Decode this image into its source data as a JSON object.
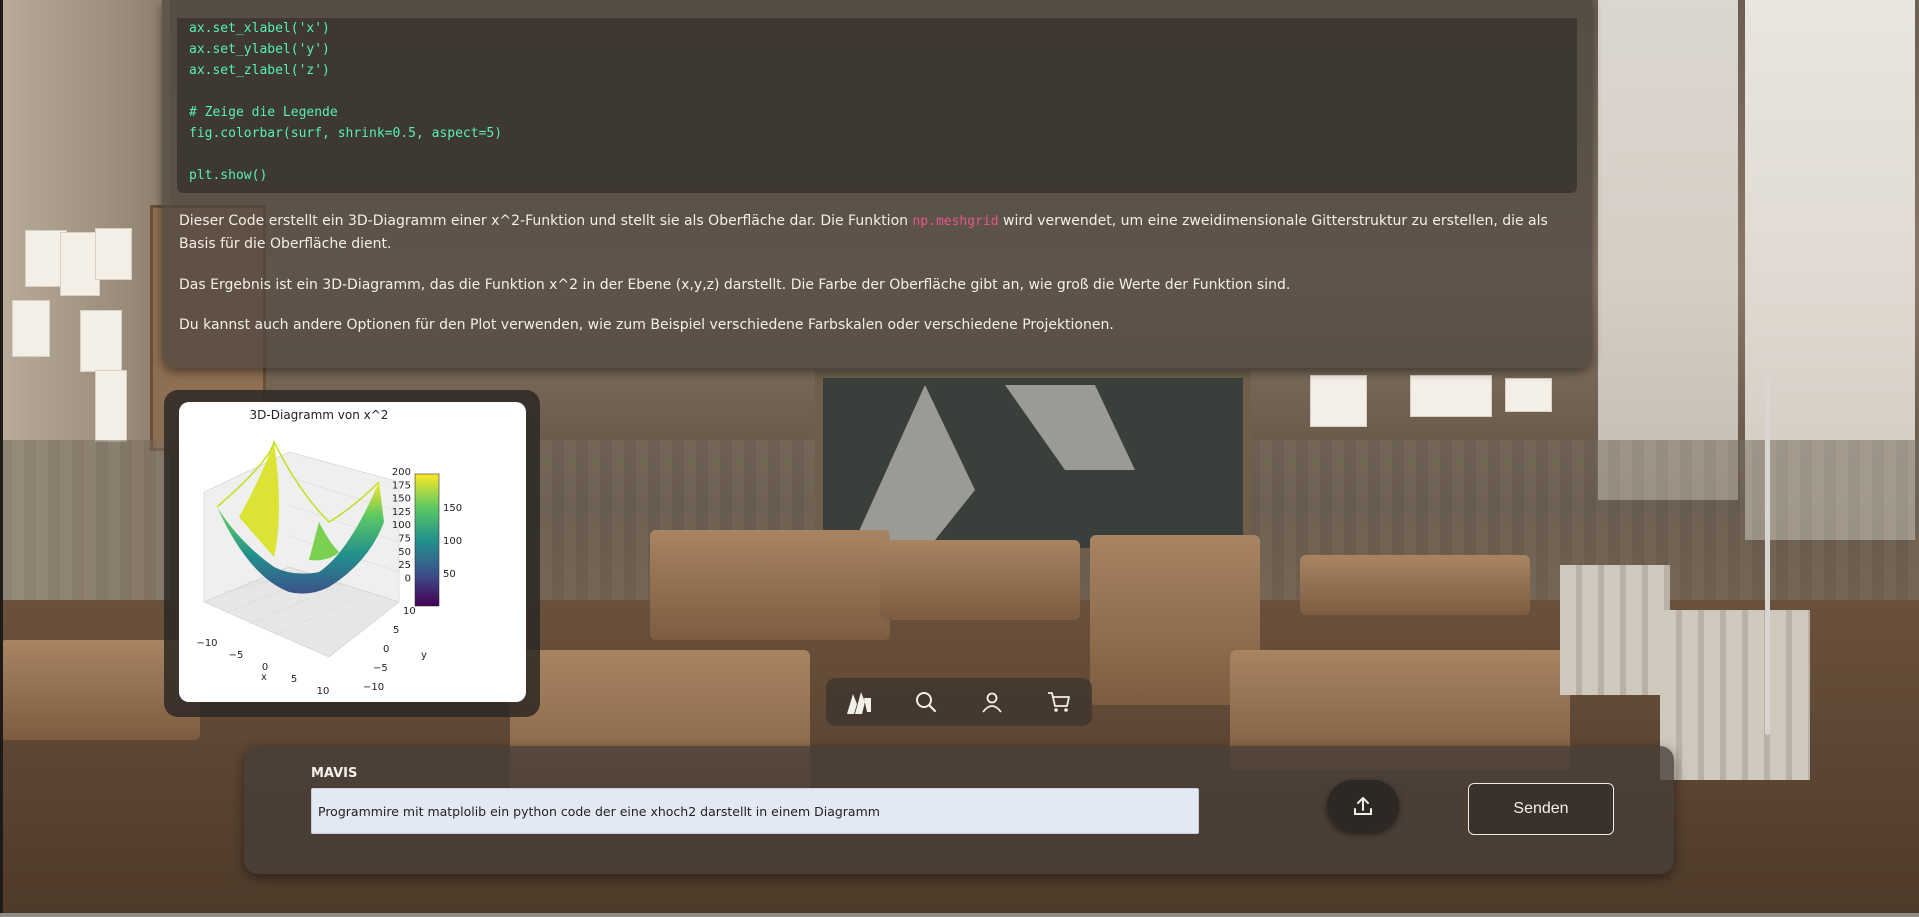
{
  "code": {
    "lines": [
      "ax.set_xlabel('x')",
      "ax.set_ylabel('y')",
      "ax.set_zlabel('z')",
      "",
      "# Zeige die Legende",
      "fig.colorbar(surf, shrink=0.5, aspect=5)",
      "",
      "plt.show()"
    ]
  },
  "response": {
    "p1_before": "Dieser Code erstellt ein 3D-Diagramm einer x^2-Funktion und stellt sie als Oberfläche dar. Die Funktion ",
    "p1_code": "np.meshgrid",
    "p1_after": " wird verwendet, um eine zweidimensionale Gitterstruktur zu erstellen, die als Basis für die Oberfläche dient.",
    "p2": "Das Ergebnis ist ein 3D-Diagramm, das die Funktion x^2 in der Ebene (x,y,z) darstellt. Die Farbe der Oberfläche gibt an, wie groß die Werte der Funktion sind.",
    "p3": "Du kannst auch andere Optionen für den Plot verwenden, wie zum Beispiel verschiedene Farbskalen oder verschiedene Projektionen."
  },
  "plot": {
    "title": "3D-Diagramm von x^2",
    "z_ticks": [
      "200",
      "175",
      "150",
      "125",
      "100",
      "75",
      "50",
      "25",
      "0"
    ],
    "colorbar_ticks": [
      "150",
      "100",
      "50"
    ],
    "x_ticks": [
      "−10",
      "−5",
      "0",
      "5",
      "10"
    ],
    "y_ticks": [
      "10",
      "5",
      "0",
      "−5",
      "−10"
    ],
    "xlabel": "x",
    "ylabel": "y",
    "colormap": [
      "#440154",
      "#3b528b",
      "#21918c",
      "#5ec962",
      "#fde725"
    ]
  },
  "chart_data": {
    "type": "surface",
    "title": "3D-Diagramm von x^2",
    "xlabel": "x",
    "ylabel": "y",
    "xlim": [
      -10,
      10
    ],
    "ylim": [
      -10,
      10
    ],
    "zlim": [
      0,
      200
    ],
    "colorbar_range": [
      0,
      200
    ],
    "colormap": "viridis",
    "function": "x^2 + y^2"
  },
  "nav": {
    "items": [
      "mavis-logo-icon",
      "search-icon",
      "user-icon",
      "cart-icon"
    ]
  },
  "input_panel": {
    "label": "MAVIS",
    "input_value": "Programmire mit matplolib ein python code der eine xhoch2 darstellt in einem Diagramm",
    "send_label": "Senden"
  },
  "colors": {
    "code_text": "#57f0b5",
    "inline_code": "#e2568d",
    "panel_bg": "#4e463e",
    "input_bg": "#e3e9f3"
  }
}
